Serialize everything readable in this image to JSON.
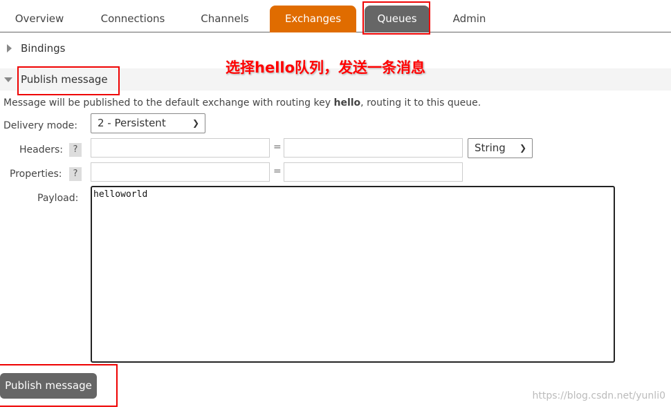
{
  "tabs": [
    {
      "label": "Overview"
    },
    {
      "label": "Connections"
    },
    {
      "label": "Channels"
    },
    {
      "label": "Exchanges"
    },
    {
      "label": "Queues"
    },
    {
      "label": "Admin"
    }
  ],
  "sections": {
    "bindings": "Bindings",
    "publish": "Publish message"
  },
  "annotation": "选择hello队列，发送一条消息",
  "description": {
    "prefix": "Message will be published to the default exchange with routing key ",
    "key": "hello",
    "suffix": ", routing it to this queue."
  },
  "form": {
    "delivery_mode_label": "Delivery mode:",
    "delivery_mode_value": "2 - Persistent",
    "headers_label": "Headers:",
    "help": "?",
    "equals": "=",
    "header_type": "String",
    "properties_label": "Properties:",
    "payload_label": "Payload:",
    "payload_value": "helloworld"
  },
  "publish_button": "Publish message",
  "watermark": "https://blog.csdn.net/yunli0",
  "colors": {
    "active_tab": "#e06c00",
    "selected_tab": "#666666",
    "annotation": "#ff0000"
  }
}
